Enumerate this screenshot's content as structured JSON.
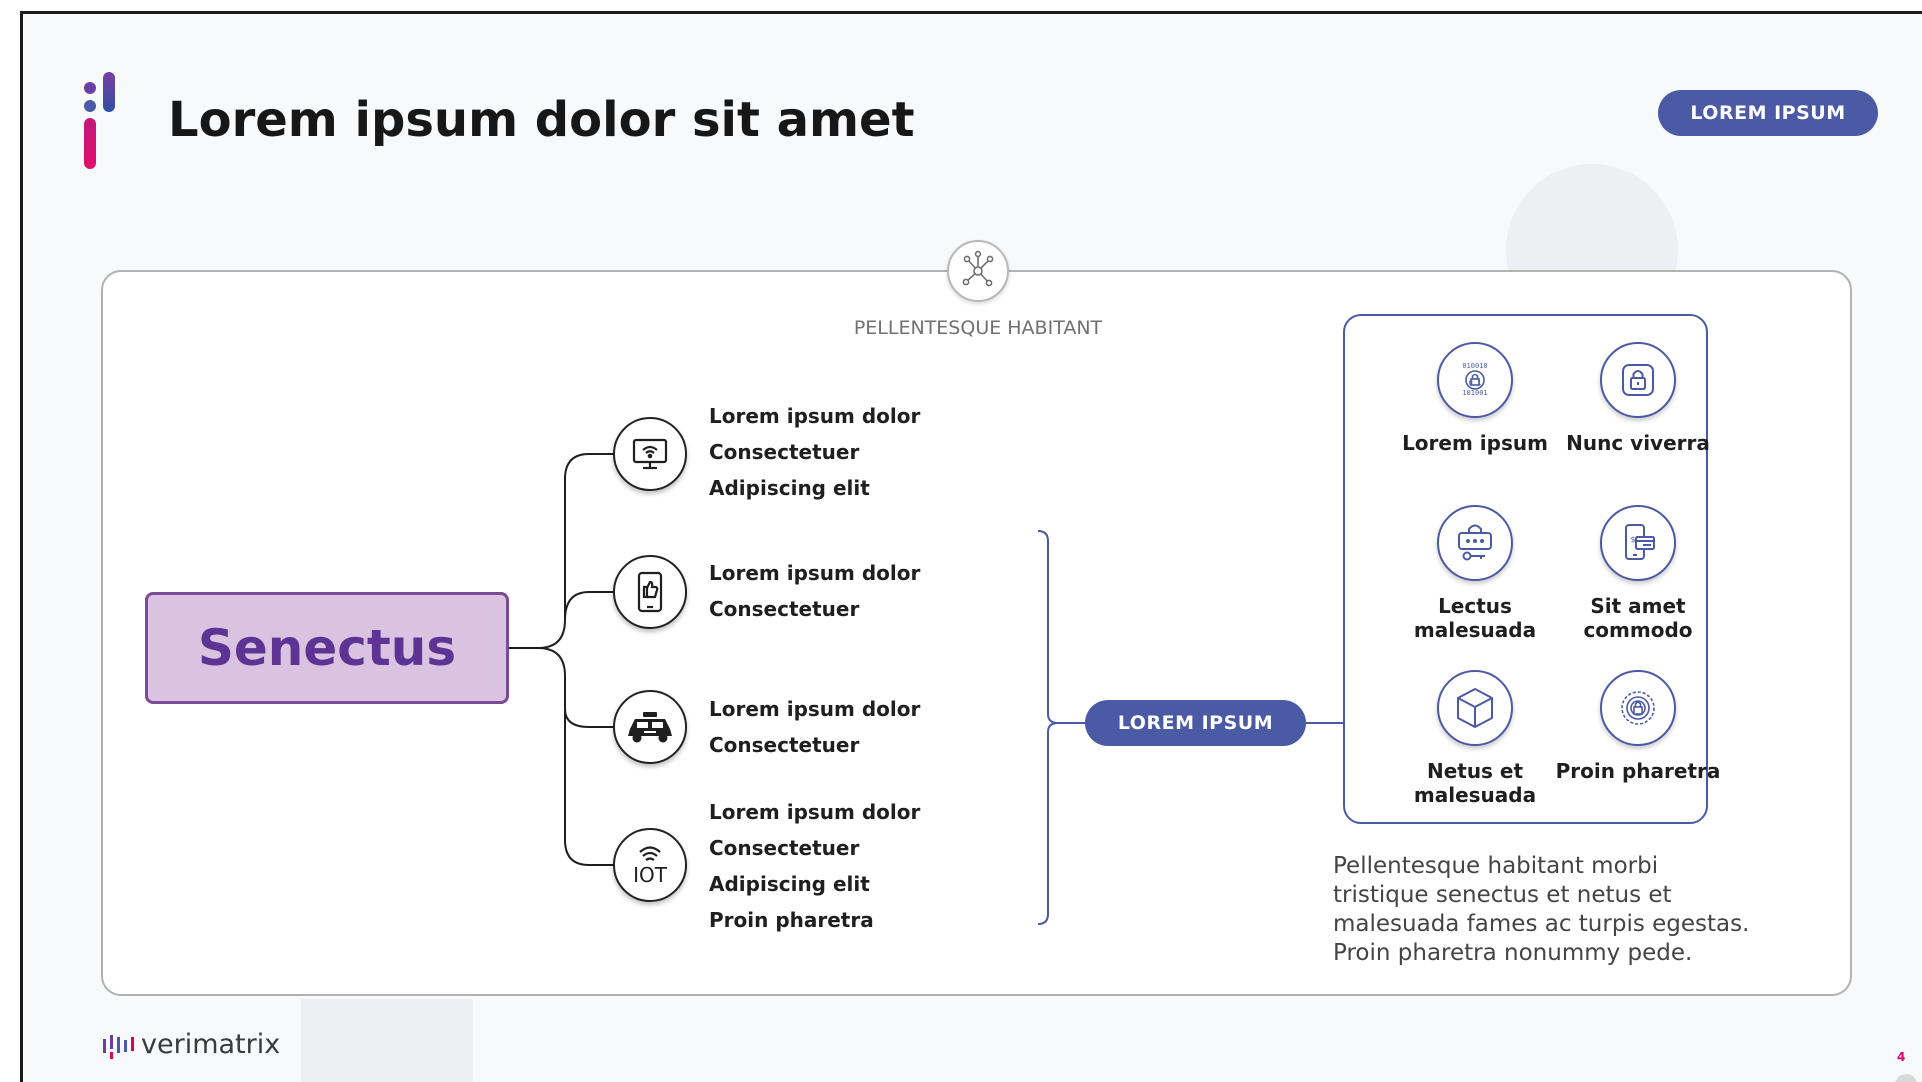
{
  "header": {
    "title": "Lorem ipsum dolor sit amet",
    "top_button": "LOREM IPSUM"
  },
  "diagram": {
    "hub_label": "PELLENTESQUE HABITANT",
    "root": "Senectus",
    "branches": [
      {
        "icon": "wifi-display-icon",
        "lines": [
          "Lorem ipsum dolor",
          "Consectetuer",
          "Adipiscing elit"
        ]
      },
      {
        "icon": "phone-thumbs-up-icon",
        "lines": [
          "Lorem ipsum dolor",
          "Consectetuer"
        ]
      },
      {
        "icon": "car-icon",
        "lines": [
          "Lorem ipsum dolor",
          "Consectetuer"
        ]
      },
      {
        "icon": "iot-icon",
        "lines": [
          "Lorem ipsum dolor",
          "Consectetuer",
          "Adipiscing elit",
          "Proin pharetra"
        ]
      }
    ],
    "middle_button": "LOREM IPSUM",
    "features": [
      {
        "icon": "binary-lock-icon",
        "label": "Lorem ipsum"
      },
      {
        "icon": "padlock-icon",
        "label": "Nunc viverra"
      },
      {
        "icon": "password-key-icon",
        "label": "Lectus malesuada"
      },
      {
        "icon": "mobile-payment-icon",
        "label": "Sit amet commodo"
      },
      {
        "icon": "cube-icon",
        "label": "Netus et malesuada"
      },
      {
        "icon": "fingerprint-lock-icon",
        "label": "Proin pharetra"
      }
    ],
    "description": "Pellentesque habitant morbi tristique senectus et netus et malesuada fames ac turpis egestas. Proin pharetra nonummy pede."
  },
  "footer": {
    "brand": "verimatrix",
    "page_number": "4"
  },
  "colors": {
    "accent_blue": "#4a5aa5",
    "accent_purple": "#5d3493",
    "root_fill": "#d9c3e1",
    "brand_pink": "#d6006f"
  }
}
